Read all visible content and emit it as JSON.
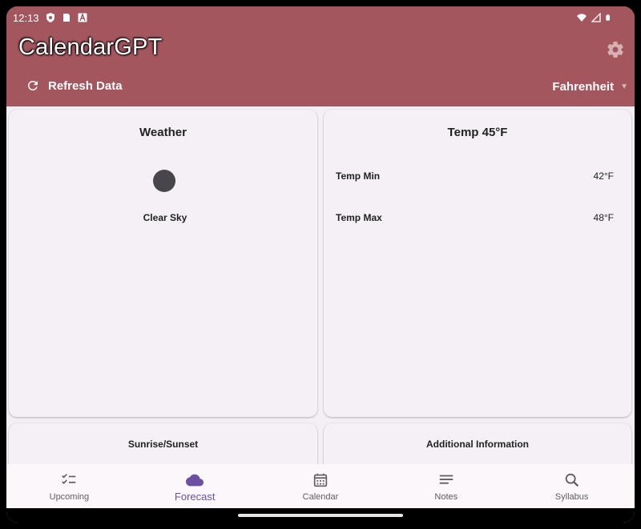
{
  "status": {
    "time": "12:13",
    "icons": [
      "shield-icon",
      "sim-icon",
      "a-icon",
      "wifi-icon",
      "signal-icon",
      "battery-icon"
    ]
  },
  "appbar": {
    "title": "CalendarGPT",
    "refresh_label": "Refresh Data",
    "units_value": "Fahrenheit",
    "color": "#a3565d"
  },
  "weather_card": {
    "title": "Weather",
    "description": "Clear Sky"
  },
  "temp_card": {
    "title": "Temp 45°F",
    "rows": [
      {
        "label": "Temp Min",
        "value": "42°F"
      },
      {
        "label": "Temp Max",
        "value": "48°F"
      }
    ]
  },
  "sun_card": {
    "title": "Sunrise/Sunset"
  },
  "info_card": {
    "title": "Additional Information"
  },
  "nav": {
    "items": [
      {
        "label": "Upcoming",
        "icon": "checklist-icon"
      },
      {
        "label": "Forecast",
        "icon": "cloud-icon",
        "active": true
      },
      {
        "label": "Calendar",
        "icon": "calendar-icon"
      },
      {
        "label": "Notes",
        "icon": "notes-icon"
      },
      {
        "label": "Syllabus",
        "icon": "search-icon"
      }
    ],
    "active_color": "#6b4fa3"
  }
}
